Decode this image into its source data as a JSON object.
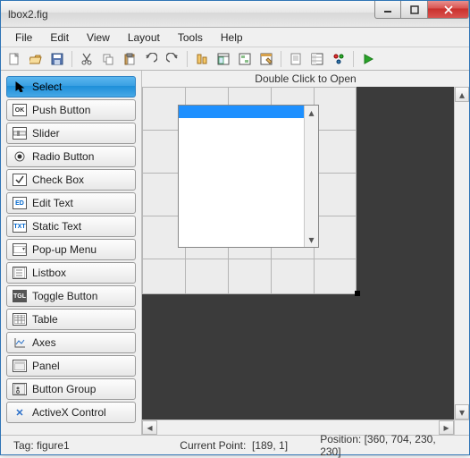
{
  "window": {
    "title": "lbox2.fig"
  },
  "menu": {
    "file": "File",
    "edit": "Edit",
    "view": "View",
    "layout": "Layout",
    "tools": "Tools",
    "help": "Help"
  },
  "toolbar": {
    "new": "new",
    "open": "open",
    "save": "save",
    "cut": "cut",
    "copy": "copy",
    "paste": "paste",
    "undo": "undo",
    "redo": "redo",
    "align": "align",
    "menu_editor": "menu-editor",
    "tab_editor": "tab-order-editor",
    "toolbar_editor": "toolbar-editor",
    "mfile_editor": "editor",
    "inspector": "property-inspector",
    "browser": "object-browser",
    "run": "run"
  },
  "palette": {
    "select": "Select",
    "push_button": "Push Button",
    "slider": "Slider",
    "radio_button": "Radio Button",
    "check_box": "Check Box",
    "edit_text": "Edit Text",
    "static_text": "Static Text",
    "popup_menu": "Pop-up Menu",
    "listbox": "Listbox",
    "toggle_button": "Toggle Button",
    "table": "Table",
    "axes": "Axes",
    "panel": "Panel",
    "button_group": "Button Group",
    "activex": "ActiveX Control"
  },
  "canvas": {
    "header": "Double Click to Open"
  },
  "status": {
    "tag_label": "Tag:",
    "tag_value": "figure1",
    "cp_label": "Current Point:",
    "cp_value": "[189, 1]",
    "pos_label": "Position:",
    "pos_value": "[360, 704, 230, 230]"
  }
}
